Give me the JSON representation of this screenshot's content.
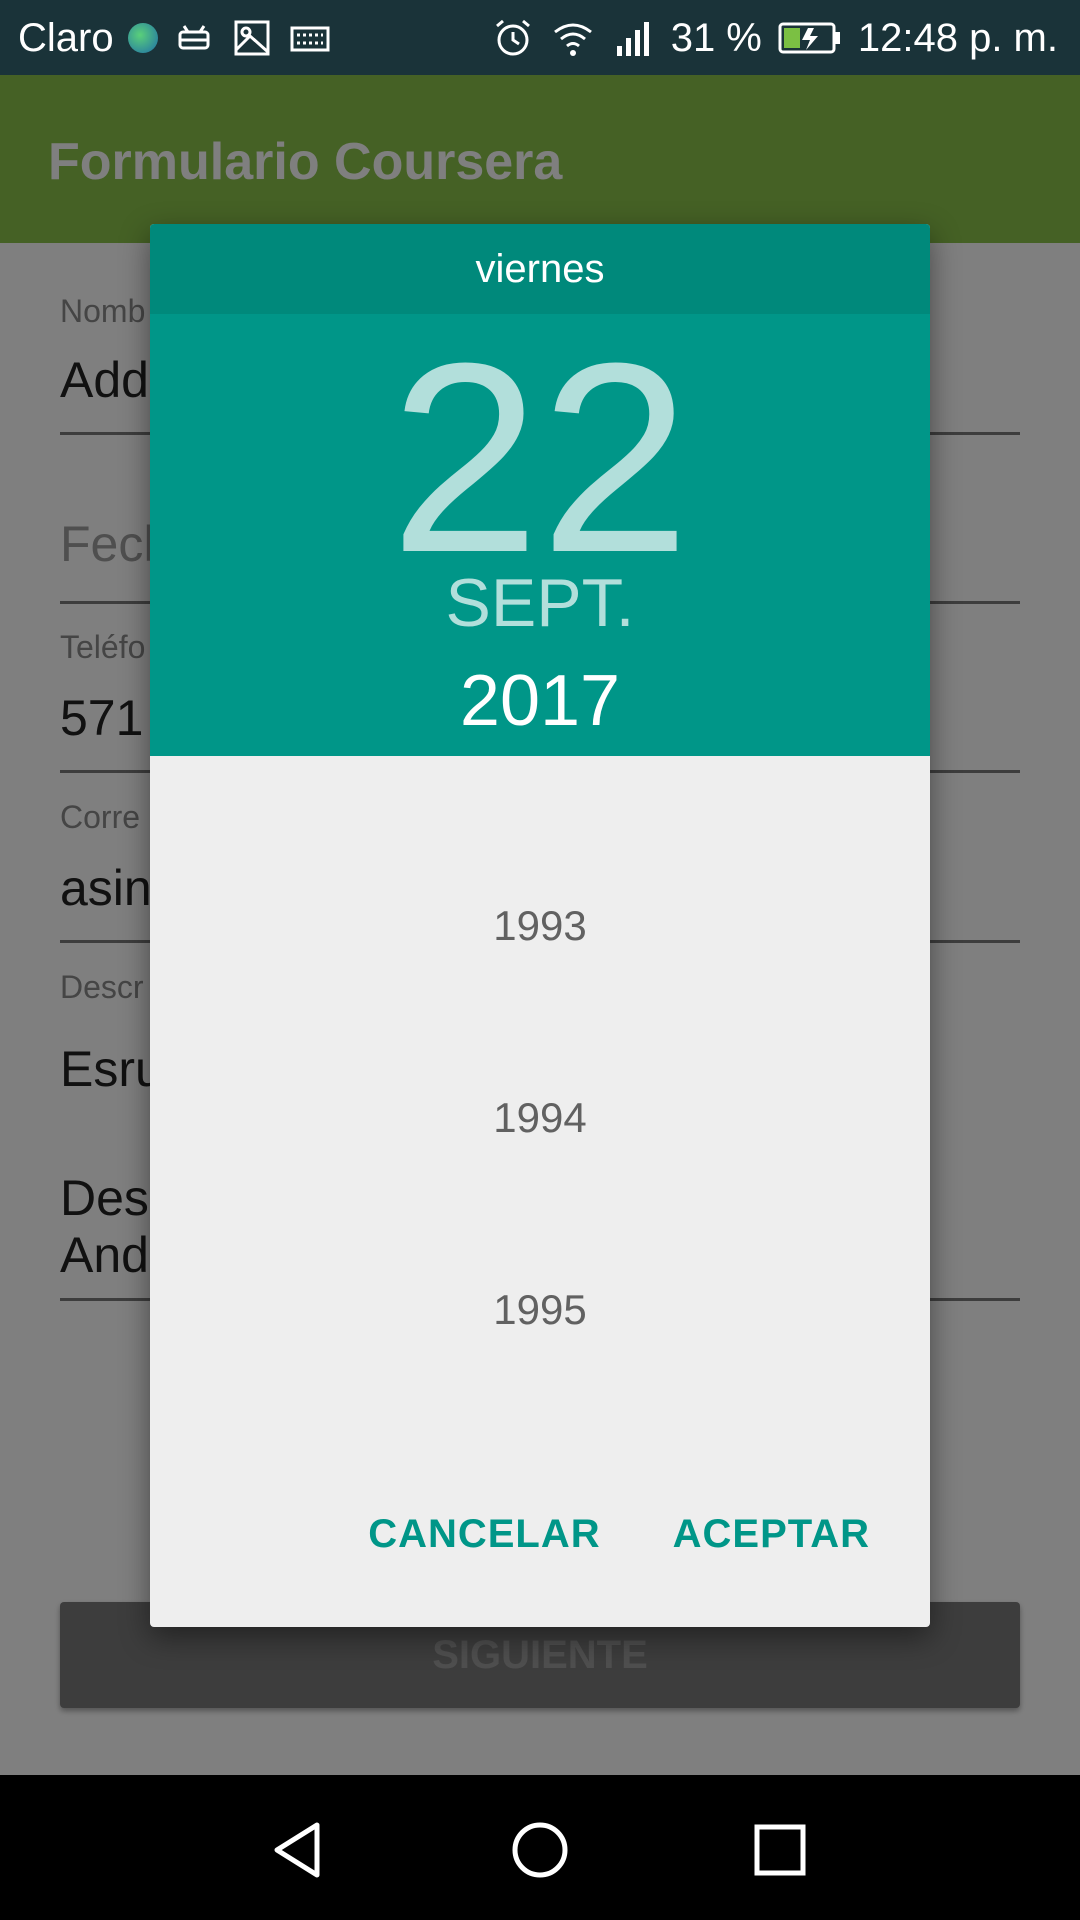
{
  "status_bar": {
    "carrier": "Claro",
    "battery_percent": "31 %",
    "time": "12:48 p. m."
  },
  "app_bar": {
    "title": "Formulario Coursera"
  },
  "form": {
    "name_label": "Nomb",
    "name_value": "Add",
    "date_hint": "Fech",
    "phone_label": "Teléfo",
    "phone_value": "571",
    "email_label": "Corre",
    "email_value": "asin",
    "desc_label": "Descr",
    "desc_value_line1": "Esru",
    "desc_value_line2": "Des",
    "desc_value_line3": "And",
    "next_button": "SIGUIENTE"
  },
  "date_picker": {
    "day_name": "viernes",
    "day": "22",
    "month": "SEPT.",
    "year": "2017",
    "years": [
      "1993",
      "1994",
      "1995"
    ],
    "cancel_label": "CANCELAR",
    "accept_label": "ACEPTAR"
  },
  "colors": {
    "accent": "#009688",
    "accent_dark": "#00897b",
    "app_bar": "#8bc34a"
  }
}
